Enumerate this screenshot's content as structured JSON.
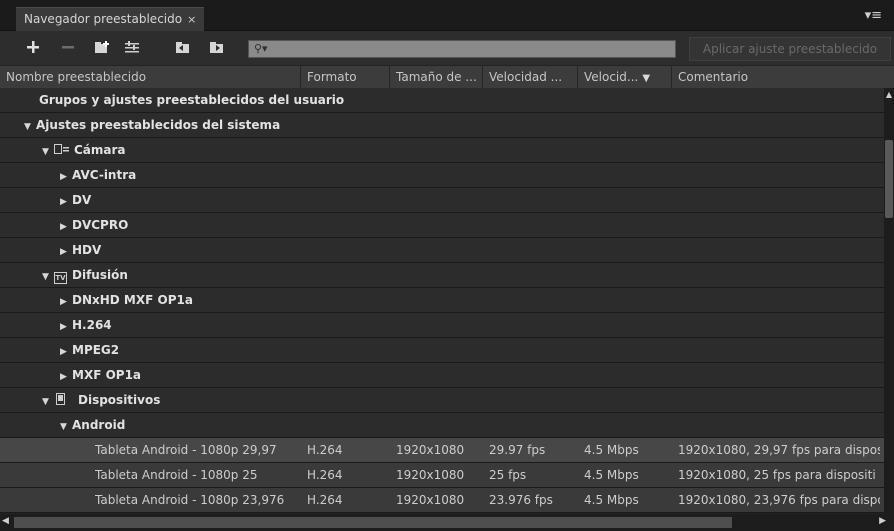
{
  "panel": {
    "tab_label": "Navegador preestablecido",
    "close_glyph": "×",
    "menu_glyph": "▾≡"
  },
  "toolbar": {
    "search_placeholder": "",
    "search_glyph": "⚲▾",
    "apply_label": "Aplicar ajuste preestablecido",
    "icons": [
      "plus-icon",
      "minus-icon",
      "new-group-icon",
      "settings-icon",
      "import-icon",
      "export-icon"
    ]
  },
  "columns": [
    "Nombre preestablecido",
    "Formato",
    "Tamaño de ...",
    "Velocidad ...",
    "Velocid...",
    "Comentario"
  ],
  "tree": [
    {
      "label": "Grupos y ajustes preestablecidos del usuario"
    },
    {
      "label": "Ajustes preestablecidos del sistema",
      "tri": "▼"
    },
    {
      "label": "Cámara",
      "tri": "▼",
      "icon": "camera-icon"
    },
    {
      "label": "AVC-intra",
      "tri": "▶"
    },
    {
      "label": "DV",
      "tri": "▶"
    },
    {
      "label": "DVCPRO",
      "tri": "▶"
    },
    {
      "label": "HDV",
      "tri": "▶"
    },
    {
      "label": "Difusión",
      "tri": "▼",
      "icon": "tv-icon",
      "icon_text": "TV"
    },
    {
      "label": "DNxHD MXF OP1a",
      "tri": "▶"
    },
    {
      "label": "H.264",
      "tri": "▶"
    },
    {
      "label": "MPEG2",
      "tri": "▶"
    },
    {
      "label": "MXF OP1a",
      "tri": "▶"
    },
    {
      "label": "Dispositivos",
      "tri": "▼",
      "icon": "device-icon"
    },
    {
      "label": "Android",
      "tri": "▼"
    }
  ],
  "presets": [
    {
      "name": "Tableta Android - 1080p 29,97",
      "format": "H.264",
      "size": "1920x1080",
      "fps": "29.97 fps",
      "bitrate": "4.5 Mbps",
      "comment": "1920x1080, 29,97 fps para dispos"
    },
    {
      "name": "Tableta Android - 1080p 25",
      "format": "H.264",
      "size": "1920x1080",
      "fps": "25 fps",
      "bitrate": "4.5 Mbps",
      "comment": "1920x1080, 25 fps para dispositi"
    },
    {
      "name": "Tableta Android - 1080p 23,976",
      "format": "H.264",
      "size": "1920x1080",
      "fps": "23.976 fps",
      "bitrate": "4.5 Mbps",
      "comment": "1920x1080, 23,976 fps para dispo"
    }
  ],
  "colors": {
    "accent": "#3a3a3a",
    "selected_row": "#474747",
    "header": "#3c3c3c"
  }
}
